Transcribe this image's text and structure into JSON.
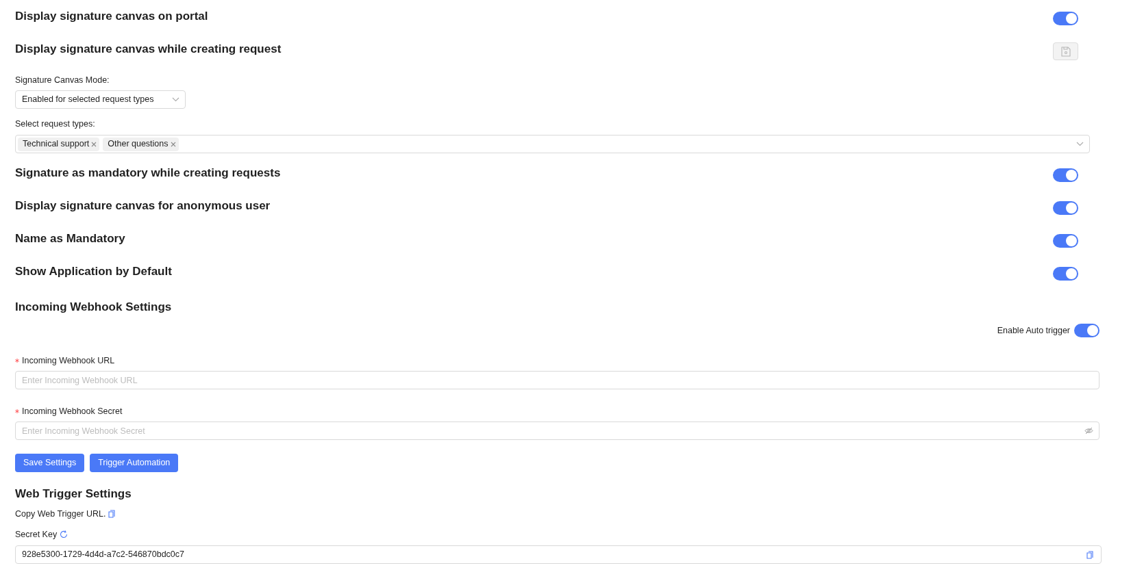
{
  "settings": [
    {
      "kind": "toggle",
      "title": "Display signature canvas on portal",
      "on": true
    },
    {
      "kind": "save",
      "title": "Display signature canvas while creating request",
      "disabled": true
    },
    {
      "kind": "select",
      "label": "Signature Canvas Mode:",
      "value": "Enabled for selected request types"
    },
    {
      "kind": "multiselect",
      "label": "Select request types:",
      "tags": [
        "Technical support",
        "Other questions"
      ]
    },
    {
      "kind": "toggle",
      "title": "Signature as mandatory while creating requests",
      "on": true
    },
    {
      "kind": "toggle",
      "title": "Display signature canvas for anonymous user",
      "on": true
    },
    {
      "kind": "toggle",
      "title": "Name as Mandatory",
      "on": true
    },
    {
      "kind": "toggle",
      "title": "Show Application by Default",
      "on": true
    }
  ],
  "webhook": {
    "title": "Incoming Webhook Settings",
    "auto_trigger": {
      "label": "Enable Auto trigger",
      "on": true
    },
    "fields": [
      {
        "label": "Incoming Webhook URL",
        "required": true,
        "placeholder": "Enter Incoming Webhook URL",
        "kind": "text"
      },
      {
        "label": "Incoming Webhook Secret",
        "required": true,
        "placeholder": "Enter Incoming Webhook Secret",
        "kind": "password"
      }
    ],
    "buttons": [
      "Save Settings",
      "Trigger Automation"
    ]
  },
  "web_trigger": {
    "title": "Web Trigger Settings",
    "copy_label": "Copy Web Trigger URL.",
    "secret_label": "Secret Key",
    "secret_value": "928e5300-1729-4d4d-a7c2-546870bdc0c7"
  }
}
